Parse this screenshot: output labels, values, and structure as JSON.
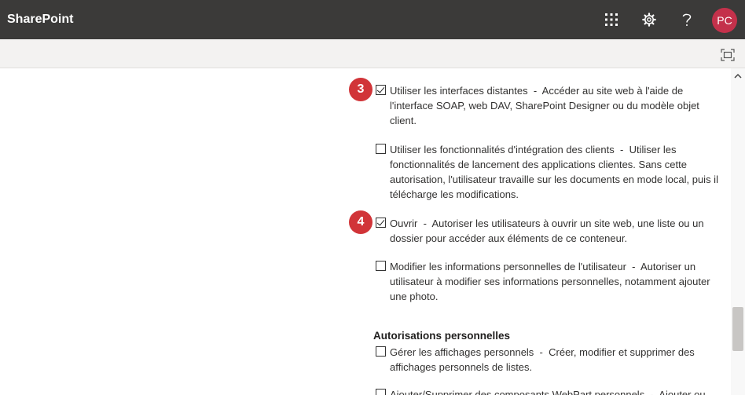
{
  "app": {
    "brand": "SharePoint",
    "avatar_initials": "PC",
    "icons": [
      "waffle-icon",
      "settings-icon",
      "help-icon"
    ],
    "colors": {
      "topbar": "#3b3a39",
      "avatar": "#c4314b",
      "badge": "#d13438"
    }
  },
  "command_bar": {
    "icons": [
      "focus-mode-icon"
    ]
  },
  "permissions": [
    {
      "label": "Utiliser les interfaces distantes",
      "separator": "-",
      "description": "Accéder au site web à l'aide de l'interface SOAP, web DAV, SharePoint Designer ou du modèle objet client.",
      "checked": true,
      "badge": "3"
    },
    {
      "label": "Utiliser les fonctionnalités d'intégration des clients",
      "separator": "-",
      "description": "Utiliser les fonctionnalités de lancement des applications clientes. Sans cette autorisation, l'utilisateur travaille sur les documents en mode local, puis il télécharge les modifications.",
      "checked": false,
      "badge": ""
    },
    {
      "label": "Ouvrir",
      "separator": "-",
      "description": "Autoriser les utilisateurs à ouvrir un site web, une liste ou un dossier pour accéder aux éléments de ce conteneur.",
      "checked": true,
      "badge": "4"
    },
    {
      "label": "Modifier les informations personnelles de l'utilisateur",
      "separator": "-",
      "description": "Autoriser un utilisateur à modifier ses informations personnelles, notamment ajouter une photo.",
      "checked": false,
      "badge": ""
    }
  ],
  "personal_section": {
    "title": "Autorisations personnelles",
    "items": [
      {
        "label": "Gérer les affichages personnels",
        "separator": "-",
        "description": "Créer, modifier et supprimer des affichages personnels de listes.",
        "checked": false
      },
      {
        "label": "Ajouter/Supprimer des composants WebPart personnels",
        "separator": "-",
        "description": "Ajouter ou",
        "checked": false
      }
    ]
  }
}
